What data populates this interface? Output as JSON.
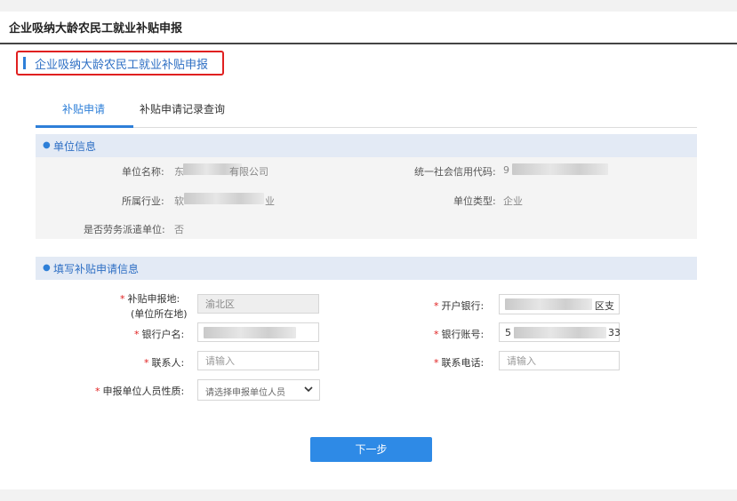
{
  "header": {
    "title": "企业吸纳大龄农民工就业补贴申报"
  },
  "section_heading": "企业吸纳大龄农民工就业补贴申报",
  "tabs": [
    {
      "label": "补贴申请",
      "active": true
    },
    {
      "label": "补贴申请记录查询",
      "active": false
    }
  ],
  "unit_info": {
    "heading": "单位信息",
    "name_label": "单位名称:",
    "name_value_start": "东",
    "name_value_end": "有限公司",
    "credit_label": "统一社会信用代码:",
    "credit_value_start": "9",
    "industry_label": "所属行业:",
    "industry_value_start": "软",
    "industry_value_end": "业",
    "type_label": "单位类型:",
    "type_value": "企业",
    "dispatch_label": "是否劳务派遣单位:",
    "dispatch_value": "否"
  },
  "apply_form": {
    "heading": "填写补贴申请信息",
    "location_label": "补贴申报地:",
    "location_sublabel": "(单位所在地)",
    "location_value": "渝北区",
    "bank_label": "开户银行:",
    "bank_value_end": "区支",
    "account_name_label": "银行户名:",
    "account_no_label": "银行账号:",
    "account_no_start": "5",
    "account_no_end": "33",
    "contact_label": "联系人:",
    "contact_placeholder": "请输入",
    "phone_label": "联系电话:",
    "phone_placeholder": "请输入",
    "nature_label": "申报单位人员性质:",
    "nature_placeholder": "请选择申报单位人员"
  },
  "next_button": "下一步",
  "colors": {
    "accent": "#2e7fd8",
    "required": "#e02020",
    "highlight_border": "#e02020"
  }
}
